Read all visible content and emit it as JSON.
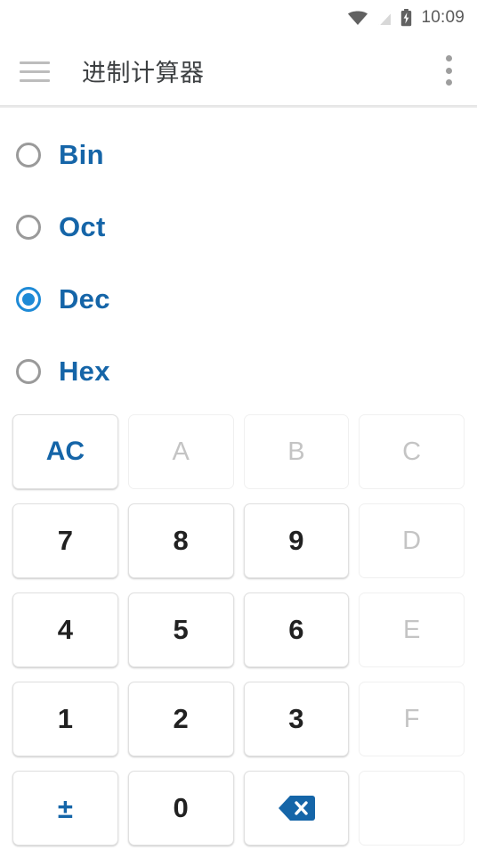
{
  "status_bar": {
    "time": "10:09",
    "icons": [
      {
        "name": "wifi-icon",
        "label": "wifi"
      },
      {
        "name": "cellular-signal-off-icon",
        "label": "no-signal"
      },
      {
        "name": "battery-charging-icon",
        "label": "battery-charging"
      }
    ]
  },
  "app_bar": {
    "menu_icon": "hamburger-menu-icon",
    "title": "进制计算器",
    "overflow_icon": "overflow-menu-icon"
  },
  "base_selector": {
    "selected": "Dec",
    "options": [
      {
        "label": "Bin",
        "checked": false
      },
      {
        "label": "Oct",
        "checked": false
      },
      {
        "label": "Dec",
        "checked": true
      },
      {
        "label": "Hex",
        "checked": false
      }
    ]
  },
  "keypad": {
    "rows": [
      [
        {
          "label": "AC",
          "state": "accent",
          "name": "key-ac"
        },
        {
          "label": "A",
          "state": "disabled",
          "name": "key-a"
        },
        {
          "label": "B",
          "state": "disabled",
          "name": "key-b"
        },
        {
          "label": "C",
          "state": "disabled",
          "name": "key-c"
        }
      ],
      [
        {
          "label": "7",
          "state": "enabled",
          "name": "key-7"
        },
        {
          "label": "8",
          "state": "enabled",
          "name": "key-8"
        },
        {
          "label": "9",
          "state": "enabled",
          "name": "key-9"
        },
        {
          "label": "D",
          "state": "disabled",
          "name": "key-d"
        }
      ],
      [
        {
          "label": "4",
          "state": "enabled",
          "name": "key-4"
        },
        {
          "label": "5",
          "state": "enabled",
          "name": "key-5"
        },
        {
          "label": "6",
          "state": "enabled",
          "name": "key-6"
        },
        {
          "label": "E",
          "state": "disabled",
          "name": "key-e"
        }
      ],
      [
        {
          "label": "1",
          "state": "enabled",
          "name": "key-1"
        },
        {
          "label": "2",
          "state": "enabled",
          "name": "key-2"
        },
        {
          "label": "3",
          "state": "enabled",
          "name": "key-3"
        },
        {
          "label": "F",
          "state": "disabled",
          "name": "key-f"
        }
      ],
      [
        {
          "label": "±",
          "state": "accent",
          "name": "key-plus-minus"
        },
        {
          "label": "0",
          "state": "enabled",
          "name": "key-0"
        },
        {
          "label": "",
          "state": "icon",
          "icon": "backspace-icon",
          "name": "key-backspace"
        },
        {
          "label": "",
          "state": "blank",
          "name": "key-blank"
        }
      ]
    ]
  },
  "colors": {
    "accent_blue": "#1565a8",
    "radio_blue": "#1e8ad6",
    "text_dark": "#212121",
    "text_disabled": "#c4c4c4",
    "title_gray": "#3c3f41",
    "icon_gray": "#9e9e9e",
    "background": "#ffffff"
  }
}
